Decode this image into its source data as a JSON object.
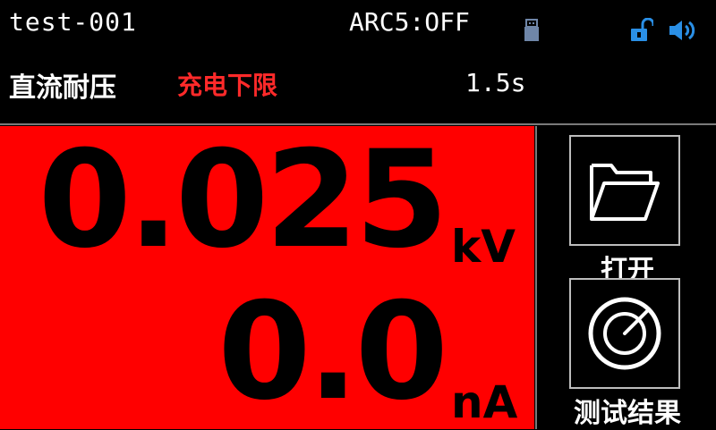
{
  "header": {
    "title": "test-001",
    "arc_status": "ARC5:OFF",
    "mode": "直流耐压",
    "stage": "充电下限",
    "time": "1.5s"
  },
  "icons": {
    "usb": "usb-icon",
    "lock": "unlock-icon",
    "speaker": "speaker-icon"
  },
  "readout": {
    "voltage": "0.025",
    "voltage_unit": "kV",
    "current": "0.0",
    "current_unit": "nA"
  },
  "side": {
    "open_label": "打开",
    "result_label": "测试结果"
  },
  "colors": {
    "readout_bg": "#ff0000",
    "stage_text": "#ff2a2a",
    "icon_blue": "#2a8fe6"
  }
}
